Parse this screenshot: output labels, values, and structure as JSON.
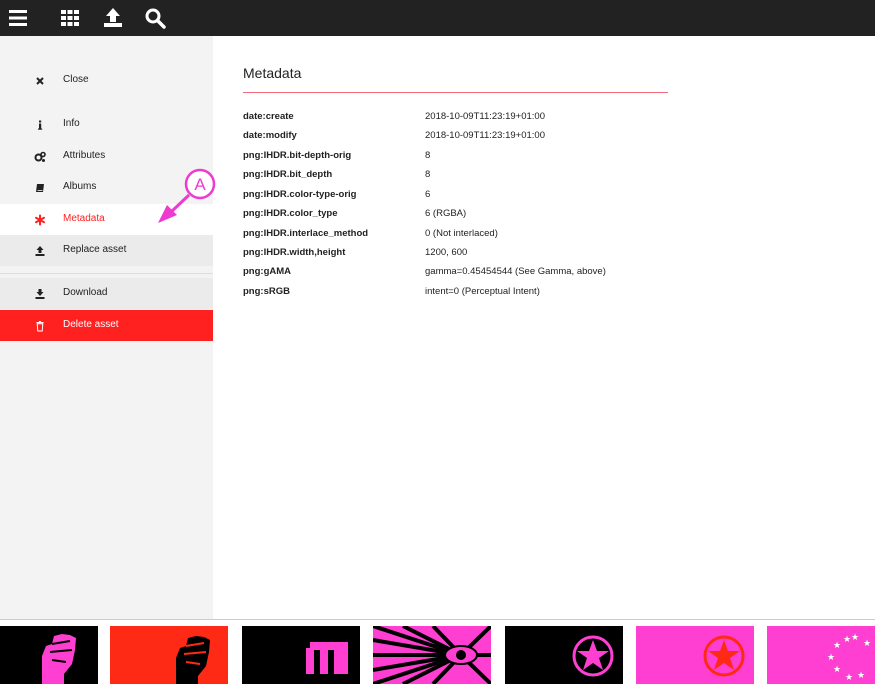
{
  "toolbar": {
    "icons": [
      "menu-icon",
      "grid-icon",
      "upload-icon",
      "search-icon"
    ]
  },
  "sidebar": {
    "items": [
      {
        "label": "Close",
        "icon": "close-icon"
      },
      {
        "label": "Info",
        "icon": "info-icon"
      },
      {
        "label": "Attributes",
        "icon": "gears-icon"
      },
      {
        "label": "Albums",
        "icon": "book-icon"
      },
      {
        "label": "Metadata",
        "icon": "asterisk-icon"
      },
      {
        "label": "Replace asset",
        "icon": "upload-icon"
      },
      {
        "label": "Download",
        "icon": "download-icon"
      },
      {
        "label": "Delete asset",
        "icon": "trash-icon"
      }
    ],
    "active_item": "Metadata"
  },
  "main": {
    "title": "Metadata",
    "rows": [
      {
        "key": "date:create",
        "value": "2018-10-09T11:23:19+01:00"
      },
      {
        "key": "date:modify",
        "value": "2018-10-09T11:23:19+01:00"
      },
      {
        "key": "png:IHDR.bit-depth-orig",
        "value": "8"
      },
      {
        "key": "png:IHDR.bit_depth",
        "value": "8"
      },
      {
        "key": "png:IHDR.color-type-orig",
        "value": "6"
      },
      {
        "key": "png:IHDR.color_type",
        "value": "6 (RGBA)"
      },
      {
        "key": "png:IHDR.interlace_method",
        "value": "0 (Not interlaced)"
      },
      {
        "key": "png:IHDR.width,height",
        "value": "1200, 600"
      },
      {
        "key": "png:gAMA",
        "value": "gamma=0.45454544 (See Gamma, above)"
      },
      {
        "key": "png:sRGB",
        "value": "intent=0 (Perceptual Intent)"
      }
    ]
  },
  "annotation": {
    "label": "A"
  },
  "thumbnails": [
    {
      "name": "fist-pink-on-black"
    },
    {
      "name": "fist-black-on-red"
    },
    {
      "name": "letter-m-pink-on-black"
    },
    {
      "name": "eye-rays-pink"
    },
    {
      "name": "star-circle-pink-on-black"
    },
    {
      "name": "star-circle-red-on-pink"
    },
    {
      "name": "stars-ring-white-on-pink"
    }
  ],
  "colors": {
    "topbar": "#222222",
    "sidebar": "#f3f3f3",
    "accent_red": "#ff2020",
    "annotation_magenta": "#ee3ad0",
    "pink": "#ff3fd1"
  }
}
